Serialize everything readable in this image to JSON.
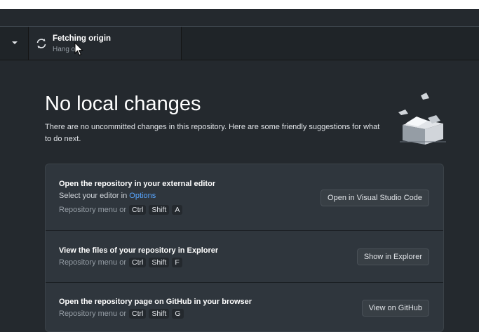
{
  "toolbar": {
    "fetch_title": "Fetching origin",
    "fetch_subtitle": "Hang o"
  },
  "main": {
    "heading": "No local changes",
    "description": "There are no uncommitted changes in this repository. Here are some friendly suggestions for what to do next."
  },
  "suggestions": [
    {
      "title": "Open the repository in your external editor",
      "line_prefix": "Select your editor in ",
      "line_link": "Options",
      "hint": "Repository menu or",
      "keys": [
        "Ctrl",
        "Shift",
        "A"
      ],
      "button": "Open in Visual Studio Code"
    },
    {
      "title": "View the files of your repository in Explorer",
      "hint": "Repository menu or",
      "keys": [
        "Ctrl",
        "Shift",
        "F"
      ],
      "button": "Show in Explorer"
    },
    {
      "title": "Open the repository page on GitHub in your browser",
      "hint": "Repository menu or",
      "keys": [
        "Ctrl",
        "Shift",
        "G"
      ],
      "button": "View on GitHub"
    }
  ],
  "colors": {
    "background": "#24292e",
    "toolbar": "#1f2428",
    "card": "#2f363d",
    "link": "#58a6ff"
  }
}
